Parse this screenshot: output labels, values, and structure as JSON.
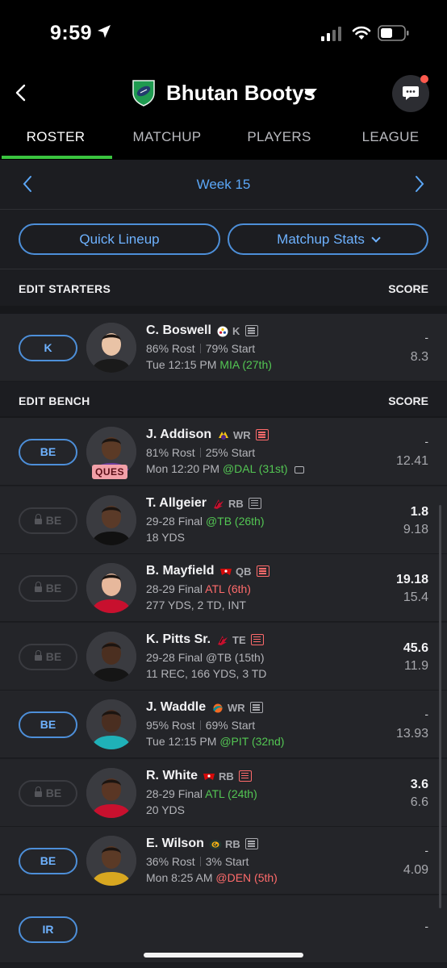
{
  "status_bar": {
    "time": "9:59"
  },
  "header": {
    "team_name": "Bhutan Bootys"
  },
  "tabs": [
    {
      "label": "ROSTER"
    },
    {
      "label": "MATCHUP"
    },
    {
      "label": "PLAYERS"
    },
    {
      "label": "LEAGUE"
    }
  ],
  "week_nav": {
    "label": "Week 15"
  },
  "actions": {
    "quick_lineup": "Quick Lineup",
    "matchup_stats": "Matchup Stats"
  },
  "starters_section": {
    "label": "EDIT STARTERS",
    "score_label": "SCORE"
  },
  "bench_section": {
    "label": "EDIT BENCH",
    "score_label": "SCORE"
  },
  "starters": [
    {
      "slot": "K",
      "name": "C. Boswell",
      "pos": "K",
      "team_icon": "steelers-logo-icon",
      "line2a": "86% Rost",
      "line2b": "79% Start",
      "line3a": "Tue 12:15 PM",
      "line3b": "MIA (27th)",
      "line3b_color": "#53c653",
      "score_top": "-",
      "score_bot": "8.3",
      "news": "dim"
    }
  ],
  "bench": [
    {
      "slot": "BE",
      "name": "J. Addison",
      "pos": "WR",
      "team_icon": "vikings-logo-icon",
      "status": "QUES",
      "line2a": "81% Rost",
      "line2b": "25% Start",
      "line3a": "Mon 12:20 PM",
      "line3b": "@DAL (31st)",
      "line3b_color": "#53c653",
      "score_top": "-",
      "score_bot": "12.41",
      "news": "hot"
    },
    {
      "slot": "BE",
      "locked": true,
      "name": "T. Allgeier",
      "pos": "RB",
      "team_icon": "falcons-logo-icon",
      "line2a": "29-28 Final",
      "line2b": "@TB (26th)",
      "line2b_color": "#53c653",
      "line3a": "18 YDS",
      "score_top": "1.8",
      "score_bot": "9.18",
      "news": "dim"
    },
    {
      "slot": "BE",
      "locked": true,
      "name": "B. Mayfield",
      "pos": "QB",
      "team_icon": "buccaneers-logo-icon",
      "line2a": "28-29 Final",
      "line2b": "ATL (6th)",
      "line2b_color": "#ff6b6b",
      "line3a": "277 YDS, 2 TD, INT",
      "score_top": "19.18",
      "score_bot": "15.4",
      "news": "hot"
    },
    {
      "slot": "BE",
      "locked": true,
      "name": "K. Pitts Sr.",
      "pos": "TE",
      "team_icon": "falcons-logo-icon",
      "line2a": "29-28 Final",
      "line2b": "@TB (15th)",
      "line2b_color": "#b3b4b9",
      "line3a": "11 REC, 166 YDS, 3 TD",
      "score_top": "45.6",
      "score_bot": "11.9",
      "news": "hot"
    },
    {
      "slot": "BE",
      "name": "J. Waddle",
      "pos": "WR",
      "team_icon": "dolphins-logo-icon",
      "line2a": "95% Rost",
      "line2b": "69% Start",
      "line3a": "Tue 12:15 PM",
      "line3b": "@PIT (32nd)",
      "line3b_color": "#53c653",
      "score_top": "-",
      "score_bot": "13.93",
      "news": "dim"
    },
    {
      "slot": "BE",
      "locked": true,
      "name": "R. White",
      "pos": "RB",
      "team_icon": "buccaneers-logo-icon",
      "line2a": "28-29 Final",
      "line2b": "ATL (24th)",
      "line2b_color": "#53c653",
      "line3a": "20 YDS",
      "score_top": "3.6",
      "score_bot": "6.6",
      "news": "hot"
    },
    {
      "slot": "BE",
      "name": "E. Wilson",
      "pos": "RB",
      "team_icon": "packers-logo-icon",
      "line2a": "36% Rost",
      "line2b": "3% Start",
      "line3a": "Mon 8:25 AM",
      "line3b": "@DEN (5th)",
      "line3b_color": "#ff6b6b",
      "score_top": "-",
      "score_bot": "4.09",
      "news": "dim"
    },
    {
      "slot": "IR",
      "empty": true,
      "score_dash": "-"
    }
  ]
}
